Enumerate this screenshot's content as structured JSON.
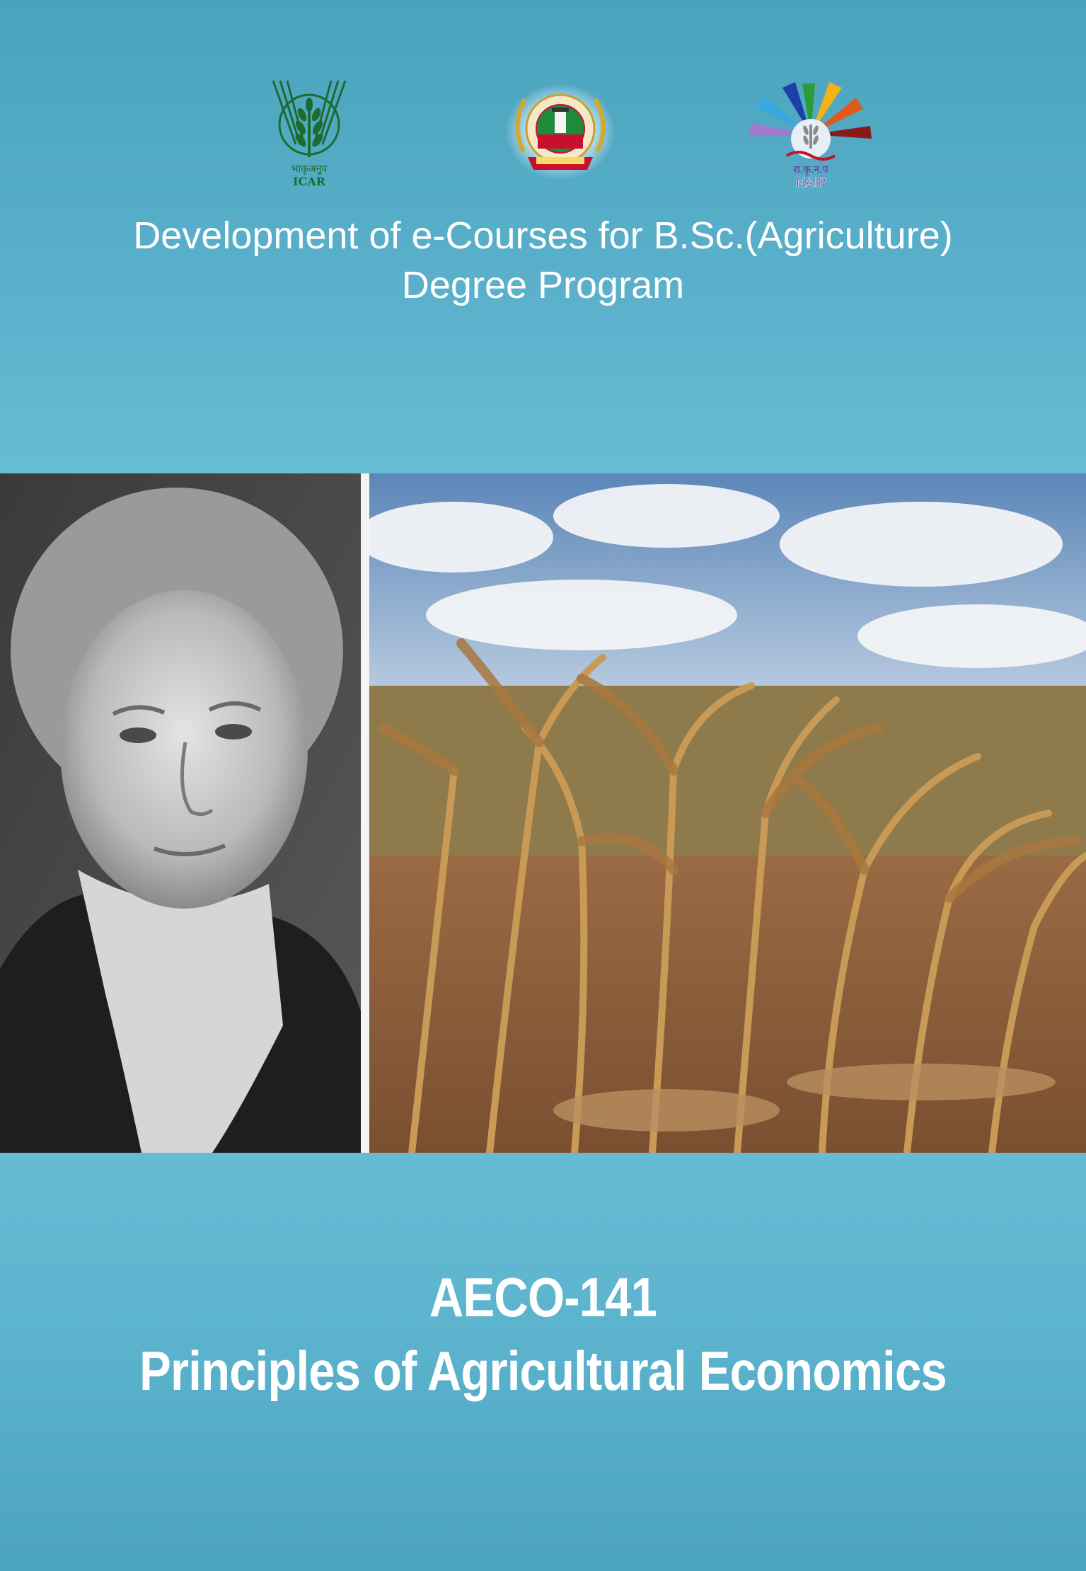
{
  "logos": {
    "icar": {
      "hindi": "भाकृअनुप",
      "label": "ICAR",
      "color": "#1d6b2f"
    },
    "tnau": {
      "color": "#c8102e"
    },
    "naip": {
      "hindi": "रा.कृ.न.प",
      "label": "NAIP",
      "color": "#6a2a9a"
    }
  },
  "header": {
    "title_line1": "Development of e-Courses for B.Sc.(Agriculture)",
    "title_line2": "Degree Program"
  },
  "course": {
    "code": "AECO-141",
    "name": "Principles of Agricultural Economics"
  },
  "colors": {
    "background_top": "#4aa2bd",
    "background_mid": "#67bcd5",
    "text": "#ffffff"
  }
}
